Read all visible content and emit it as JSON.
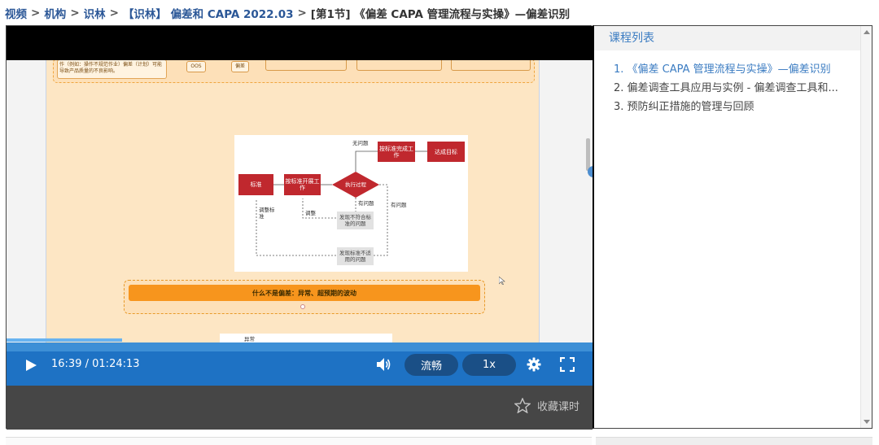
{
  "breadcrumb": {
    "items": [
      "视频",
      "机构",
      "识林",
      "【识林】 偏差和 CAPA 2022.03"
    ],
    "current": "[第1节] 《偏差 CAPA 管理流程与实操》—偏差识别",
    "separator": ">"
  },
  "slide": {
    "top_box_text": "作（例如：操作不规范作业）偏差（计划）可能导致产品质量的不良影响。",
    "top_pill_1": "OOS",
    "top_pill_2": "偏差",
    "flow": {
      "standard": "标准",
      "work": "按标准开展工作",
      "execute": "执行过程",
      "complete": "按标准完成工作",
      "goal": "达成目标",
      "no_problem": "无问题",
      "has_problem_1": "有问题",
      "has_problem_2": "有问题",
      "adjust_standard": "调整标准",
      "adjust": "调整",
      "nonconform": "发现不符合标准的问题",
      "inapplicable": "发现标准不适用的问题"
    },
    "orange_bar": "什么不是偏差：异常、超预期的波动",
    "chart_caption": "异常"
  },
  "player": {
    "current_time": "16:39",
    "total_time": "01:24:13",
    "time_separator": "/",
    "quality": "流畅",
    "speed": "1x",
    "favorite": "收藏课时",
    "progress": 0.197
  },
  "course_panel": {
    "title": "课程列表",
    "items": [
      "1. 《偏差 CAPA 管理流程与实操》—偏差识别",
      "2. 偏差调查工具应用与实例 - 偏差调查工具和...",
      "3. 预防纠正措施的管理与回顾"
    ],
    "active_index": 0
  },
  "colors": {
    "brand_blue": "#1e72c4",
    "link_blue": "#3b7cc2",
    "flow_red": "#c0282e",
    "slide_orange": "#f7951d"
  },
  "icons": [
    "play-icon",
    "volume-icon",
    "gear-icon",
    "fullscreen-icon",
    "star-icon"
  ]
}
